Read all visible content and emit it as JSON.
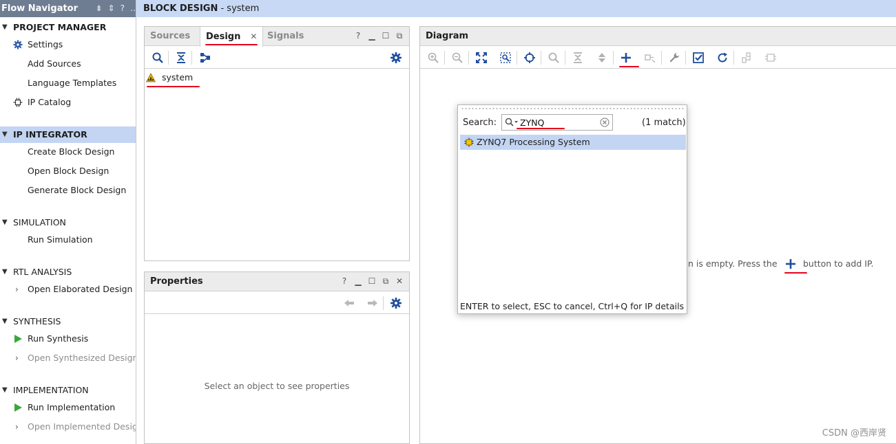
{
  "flow_navigator": {
    "title": "Flow Navigator",
    "sections": [
      {
        "label": "PROJECT MANAGER",
        "items": [
          "Settings",
          "Add Sources",
          "Language Templates",
          "IP Catalog"
        ]
      },
      {
        "label": "IP INTEGRATOR",
        "items": [
          "Create Block Design",
          "Open Block Design",
          "Generate Block Design"
        ]
      },
      {
        "label": "SIMULATION",
        "items": [
          "Run Simulation"
        ]
      },
      {
        "label": "RTL ANALYSIS",
        "items": [
          "Open Elaborated Design"
        ]
      },
      {
        "label": "SYNTHESIS",
        "items": [
          "Run Synthesis",
          "Open Synthesized Design"
        ]
      },
      {
        "label": "IMPLEMENTATION",
        "items": [
          "Run Implementation",
          "Open Implemented Design"
        ]
      }
    ]
  },
  "title_bar": {
    "bold": "BLOCK DESIGN",
    "rest": " - system"
  },
  "design_panel": {
    "tabs": [
      "Sources",
      "Design",
      "Signals"
    ],
    "active_tab": "Design",
    "tree": [
      "system"
    ]
  },
  "properties_panel": {
    "title": "Properties",
    "empty": "Select an object to see properties"
  },
  "diagram_panel": {
    "title": "Diagram",
    "hint_left": "n is empty. Press the",
    "hint_right": "button to add IP."
  },
  "popup": {
    "search_label": "Search:",
    "search_value": "ZYNQ",
    "match_text": "(1 match)",
    "results": [
      "ZYNQ7 Processing System"
    ],
    "footer": "ENTER to select, ESC to cancel, Ctrl+Q for IP details"
  },
  "watermark": "CSDN @西岸贤",
  "colors": {
    "nav_header": "#6f7d93",
    "selection": "#c3d5f3",
    "title_bar": "#c7d9f5",
    "annotation": "#e3001b",
    "accent_blue": "#1f4e9c",
    "run_green": "#3aa83a"
  },
  "icons": [
    "gear-icon",
    "ip-catalog-icon",
    "warning-icon",
    "search-icon",
    "collapse-icon",
    "hierarchy-icon",
    "zoom-in-icon",
    "zoom-out-icon",
    "fit-icon",
    "zoom-area-icon",
    "center-icon",
    "plus-icon",
    "wrench-icon",
    "validate-icon",
    "refresh-icon",
    "play-icon",
    "ip-core-icon",
    "clear-icon"
  ]
}
